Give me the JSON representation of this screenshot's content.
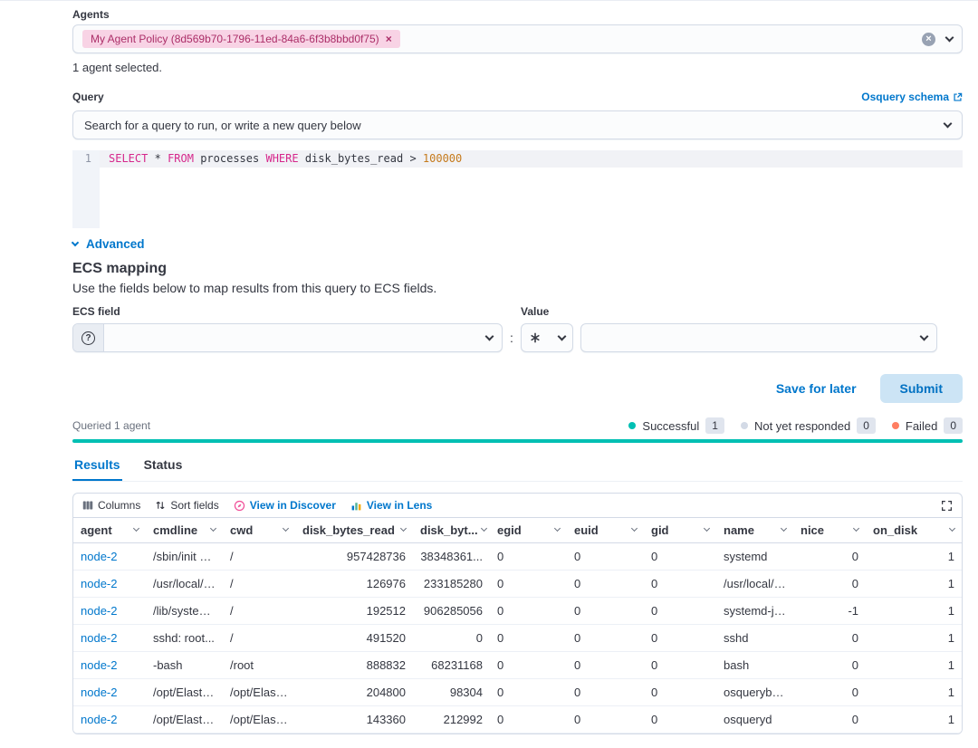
{
  "agents": {
    "label": "Agents",
    "badge": "My Agent Policy (8d569b70-1796-11ed-84a6-6f3b8bbd0f75)",
    "badge_close": "×",
    "selected_text": "1 agent selected."
  },
  "query": {
    "label": "Query",
    "schema_link_label": "Osquery schema",
    "select_placeholder": "Search for a query to run, or write a new query below",
    "editor": {
      "line_number": "1",
      "sql": {
        "kw_select": "SELECT",
        "star": "*",
        "kw_from": "FROM",
        "table": "processes",
        "kw_where": "WHERE",
        "column": "disk_bytes_read",
        "operator": ">",
        "value": "100000"
      }
    },
    "advanced_label": "Advanced"
  },
  "ecs": {
    "title": "ECS mapping",
    "description": "Use the fields below to map results from this query to ECS fields.",
    "field_label": "ECS field",
    "value_label": "Value",
    "separator": ":",
    "help_glyph": "?"
  },
  "actions": {
    "save_label": "Save for later",
    "submit_label": "Submit"
  },
  "status": {
    "queried_text": "Queried 1 agent",
    "legend": [
      {
        "label": "Successful",
        "count": "1",
        "color": "#00BFB3"
      },
      {
        "label": "Not yet responded",
        "count": "0",
        "color": "#D3DAE6"
      },
      {
        "label": "Failed",
        "count": "0",
        "color": "#FF7E62"
      }
    ]
  },
  "tabs": [
    {
      "label": "Results"
    },
    {
      "label": "Status"
    }
  ],
  "grid": {
    "toolbar": {
      "columns_label": "Columns",
      "sort_label": "Sort fields",
      "discover_label": "View in Discover",
      "lens_label": "View in Lens"
    },
    "columns": [
      "agent",
      "cmdline",
      "cwd",
      "disk_bytes_read",
      "disk_byt...",
      "egid",
      "euid",
      "gid",
      "name",
      "nice",
      "on_disk"
    ],
    "rows": [
      {
        "agent": "node-2",
        "cmdline": "/sbin/init n...",
        "cwd": "/",
        "disk_bytes_read": "957428736",
        "disk_bytes_written": "38348361...",
        "egid": "0",
        "euid": "0",
        "gid": "0",
        "name": "systemd",
        "nice": "0",
        "on_disk": "1"
      },
      {
        "agent": "node-2",
        "cmdline": "/usr/local/c...",
        "cwd": "/",
        "disk_bytes_read": "126976",
        "disk_bytes_written": "233185280",
        "egid": "0",
        "euid": "0",
        "gid": "0",
        "name": "/usr/local/c...",
        "nice": "0",
        "on_disk": "1"
      },
      {
        "agent": "node-2",
        "cmdline": "/lib/system...",
        "cwd": "/",
        "disk_bytes_read": "192512",
        "disk_bytes_written": "906285056",
        "egid": "0",
        "euid": "0",
        "gid": "0",
        "name": "systemd-jo...",
        "nice": "-1",
        "on_disk": "1"
      },
      {
        "agent": "node-2",
        "cmdline": "sshd: root...",
        "cwd": "/",
        "disk_bytes_read": "491520",
        "disk_bytes_written": "0",
        "egid": "0",
        "euid": "0",
        "gid": "0",
        "name": "sshd",
        "nice": "0",
        "on_disk": "1"
      },
      {
        "agent": "node-2",
        "cmdline": "-bash",
        "cwd": "/root",
        "disk_bytes_read": "888832",
        "disk_bytes_written": "68231168",
        "egid": "0",
        "euid": "0",
        "gid": "0",
        "name": "bash",
        "nice": "0",
        "on_disk": "1"
      },
      {
        "agent": "node-2",
        "cmdline": "/opt/Elastic...",
        "cwd": "/opt/Elastic...",
        "disk_bytes_read": "204800",
        "disk_bytes_written": "98304",
        "egid": "0",
        "euid": "0",
        "gid": "0",
        "name": "osquerybeat",
        "nice": "0",
        "on_disk": "1"
      },
      {
        "agent": "node-2",
        "cmdline": "/opt/Elastic...",
        "cwd": "/opt/Elastic...",
        "disk_bytes_read": "143360",
        "disk_bytes_written": "212992",
        "egid": "0",
        "euid": "0",
        "gid": "0",
        "name": "osqueryd",
        "nice": "0",
        "on_disk": "1"
      }
    ]
  },
  "colors": {
    "primary": "#0077CC",
    "badge_bg": "#F8D3E5",
    "badge_text": "#AB2E68",
    "success": "#00BFB3",
    "pending": "#D3DAE6",
    "failed": "#FF7E62"
  }
}
